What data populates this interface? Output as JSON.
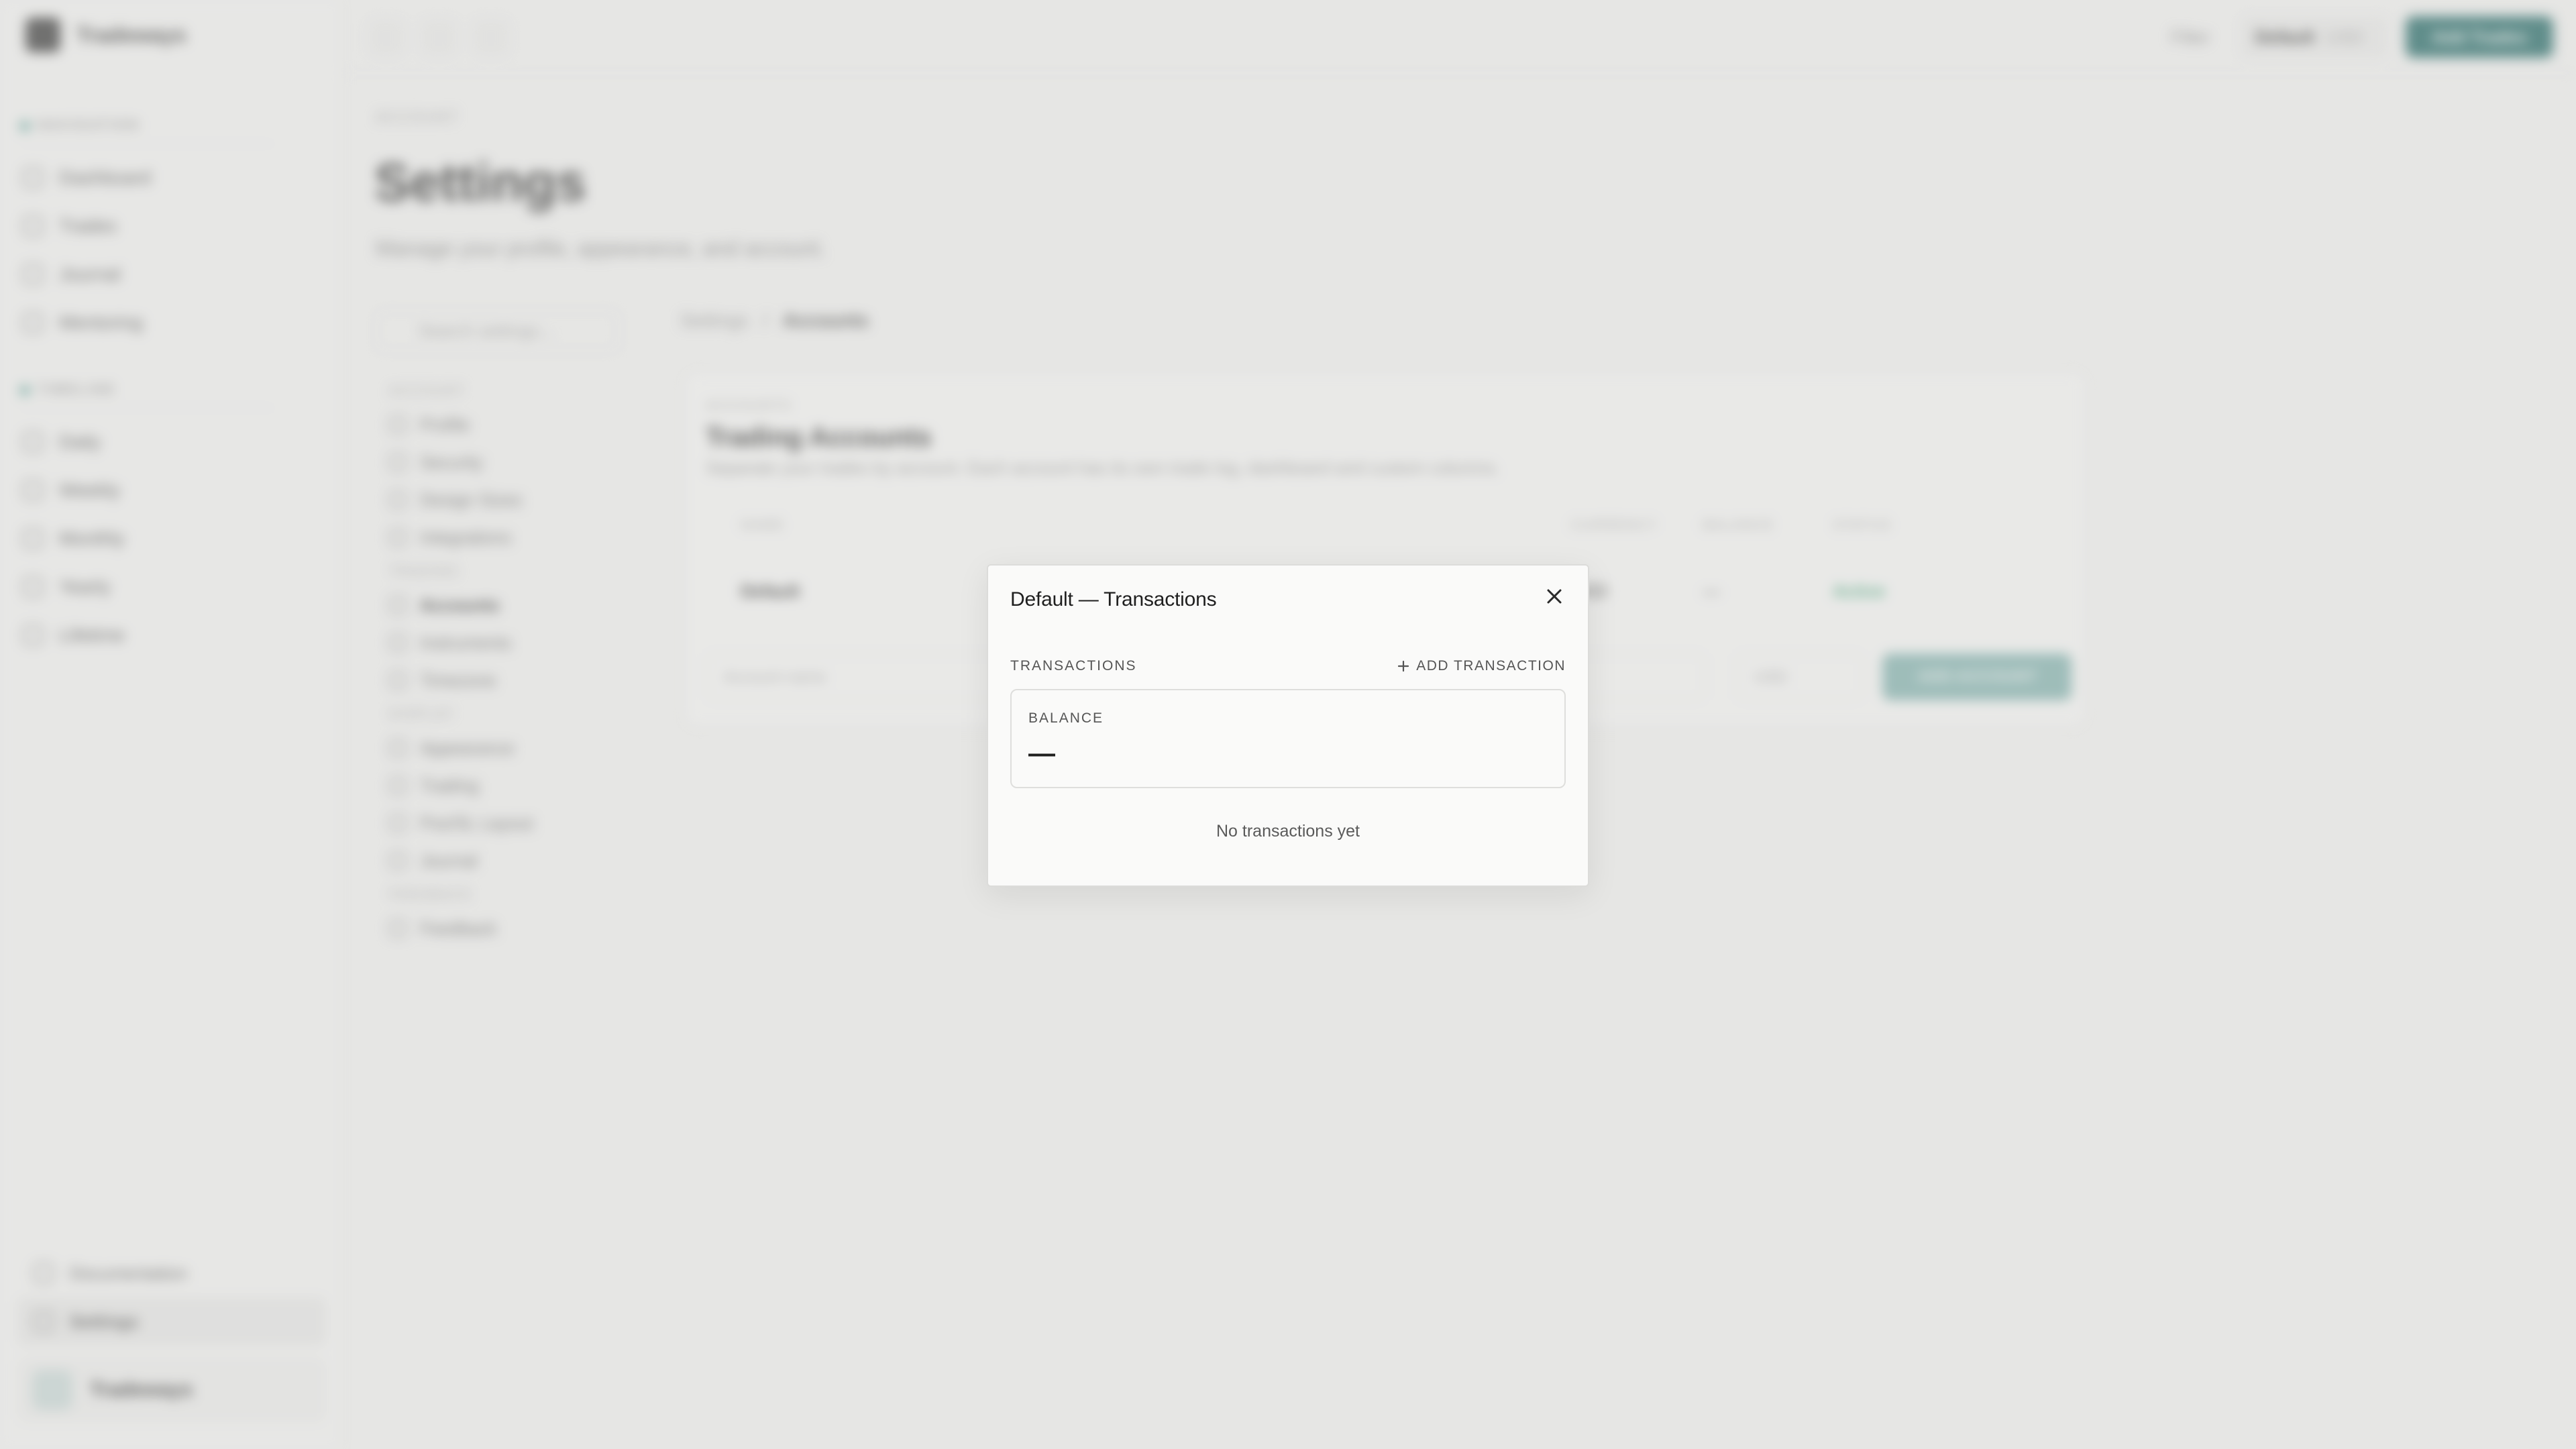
{
  "app": {
    "brand": "Tradeways"
  },
  "topbar": {
    "filter_label": "Filter",
    "account_select": "Default",
    "account_currency": "USD",
    "primary_button": "Add Trades"
  },
  "sidebar": {
    "sections": [
      {
        "title": "NAVIGATION",
        "items": [
          "Dashboard",
          "Trades",
          "Journal",
          "Mentoring"
        ]
      },
      {
        "title": "TIMELINE",
        "items": [
          "Daily",
          "Weekly",
          "Monthly",
          "Yearly",
          "Lifetime"
        ]
      }
    ],
    "bottom": {
      "documentation": "Documentation",
      "settings": "Settings",
      "user": "Tradeways"
    }
  },
  "page": {
    "kicker": "ACCOUNT",
    "title": "Settings",
    "subtitle": "Manage your profile, appearance, and account."
  },
  "settings_nav": {
    "search_placeholder": "Search settings...",
    "groups": [
      {
        "title": "ACCOUNT",
        "items": [
          "Profile",
          "Security",
          "Design Sizes",
          "Integrations"
        ]
      },
      {
        "title": "TRADING",
        "items": [
          "Accounts",
          "Instruments",
          "Timezone"
        ]
      },
      {
        "title": "DISPLAY",
        "items": [
          "Appearance",
          "Trading",
          "Pos/SL Layout",
          "Journal"
        ]
      },
      {
        "title": "FEEDBACK",
        "items": [
          "Feedback"
        ]
      }
    ]
  },
  "breadcrumb": {
    "root": "Settings",
    "separator": "/",
    "current": "Accounts"
  },
  "accounts": {
    "kicker": "ACCOUNTS",
    "title": "Trading Accounts",
    "description": "Separate your trades by account. Each account has its own trade log, dashboard and custom columns.",
    "columns": {
      "name": "NAME",
      "currency": "CURRENCY",
      "balance": "BALANCE",
      "status": "STATUS"
    },
    "row": {
      "name": "Default",
      "currency": "USD",
      "balance": "—",
      "status": "Active"
    },
    "new_name_placeholder": "Account name",
    "new_currency": "USD",
    "add_button": "ADD ACCOUNT"
  },
  "modal": {
    "title": "Default — Transactions",
    "section_label": "TRANSACTIONS",
    "add_transaction": "ADD TRANSACTION",
    "balance_label": "BALANCE",
    "balance_value": "—",
    "empty_message": "No transactions yet"
  },
  "colors": {
    "accent": "#0f5d5a",
    "status_active": "#2f9b6a"
  }
}
